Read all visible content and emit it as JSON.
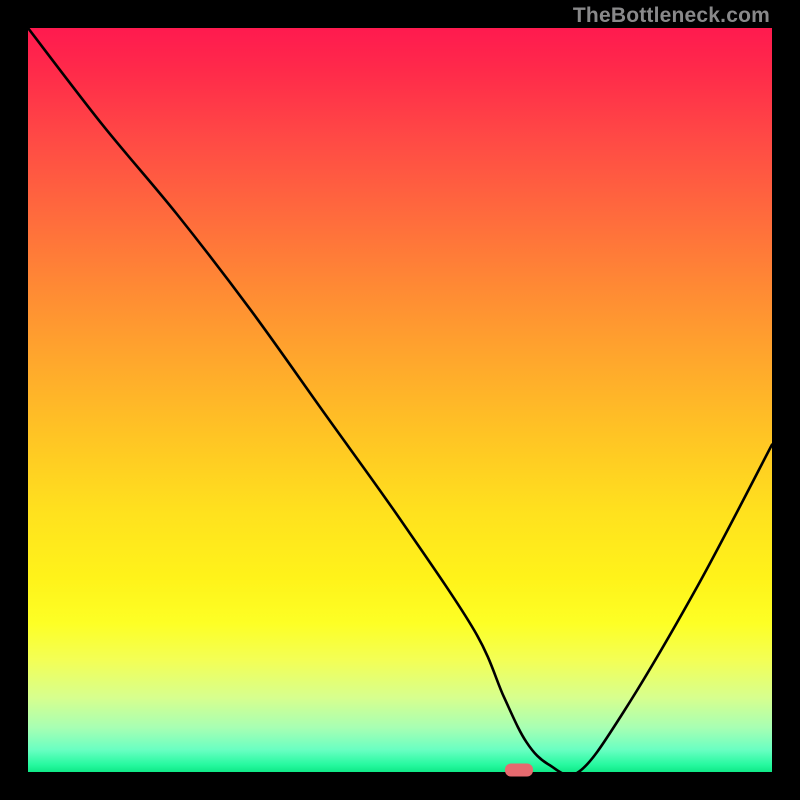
{
  "watermark": "TheBottleneck.com",
  "chart_data": {
    "type": "line",
    "title": "",
    "xlabel": "",
    "ylabel": "",
    "xlim": [
      0,
      100
    ],
    "ylim": [
      0,
      100
    ],
    "grid": false,
    "series": [
      {
        "name": "curve",
        "x": [
          0,
          10,
          20,
          30,
          40,
          50,
          60,
          64,
          67,
          70,
          74,
          80,
          90,
          100
        ],
        "y": [
          100,
          87,
          75,
          62,
          48,
          34,
          19,
          10,
          4,
          1,
          0,
          8,
          25,
          44
        ]
      }
    ],
    "marker": {
      "x": 66,
      "y": 0,
      "color": "#e66a6f"
    },
    "background_gradient": {
      "top": "#ff1a4f",
      "mid": "#ffe11e",
      "bottom": "#0fe987"
    }
  }
}
